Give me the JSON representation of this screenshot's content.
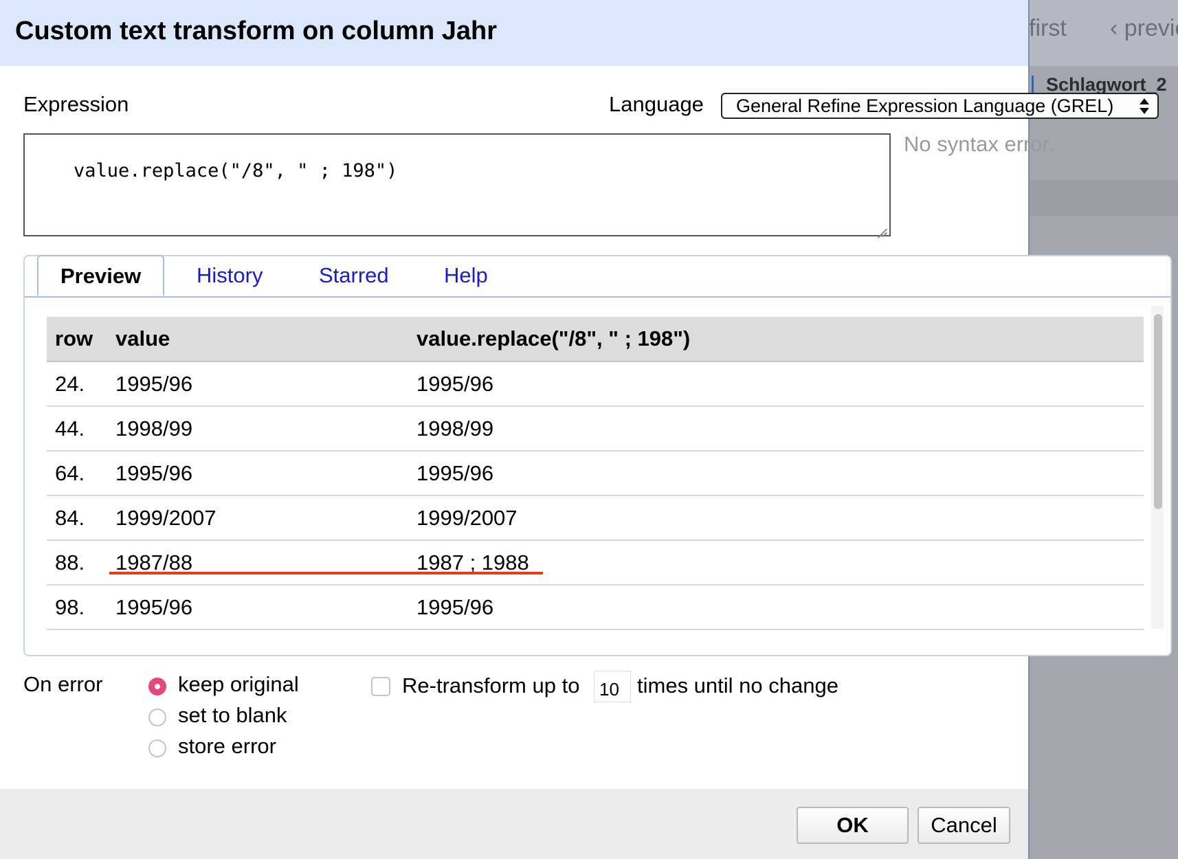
{
  "background": {
    "pager_first": "first",
    "pager_previous": "‹ previc",
    "column_header": "Schlagwort_2"
  },
  "dialog": {
    "title": "Custom text transform on column Jahr",
    "expression_label": "Expression",
    "language_label": "Language",
    "language_selected": "General Refine Expression Language (GREL)",
    "expression": "value.replace(\"/8\", \" ; 198\")",
    "syntax_status": "No syntax error."
  },
  "tabs": [
    {
      "label": "Preview",
      "active": true
    },
    {
      "label": "History",
      "active": false
    },
    {
      "label": "Starred",
      "active": false
    },
    {
      "label": "Help",
      "active": false
    }
  ],
  "preview": {
    "headers": [
      "row",
      "value",
      "value.replace(\"/8\", \" ; 198\")"
    ],
    "rows": [
      {
        "row": "24.",
        "value": "1995/96",
        "result": "1995/96"
      },
      {
        "row": "44.",
        "value": "1998/99",
        "result": "1998/99"
      },
      {
        "row": "64.",
        "value": "1995/96",
        "result": "1995/96"
      },
      {
        "row": "84.",
        "value": "1999/2007",
        "result": "1999/2007"
      },
      {
        "row": "88.",
        "value": "1987/88",
        "result": "1987 ; 1988"
      },
      {
        "row": "98.",
        "value": "1995/96",
        "result": "1995/96"
      }
    ],
    "highlight_color": "#f03a17"
  },
  "on_error": {
    "label": "On error",
    "options": [
      {
        "label": "keep original",
        "checked": true
      },
      {
        "label": "set to blank",
        "checked": false
      },
      {
        "label": "store error",
        "checked": false
      }
    ]
  },
  "retransform": {
    "checked": false,
    "label_before": "Re-transform up to",
    "count": "10",
    "label_after": "times until no change"
  },
  "footer": {
    "ok_label": "OK",
    "cancel_label": "Cancel"
  }
}
